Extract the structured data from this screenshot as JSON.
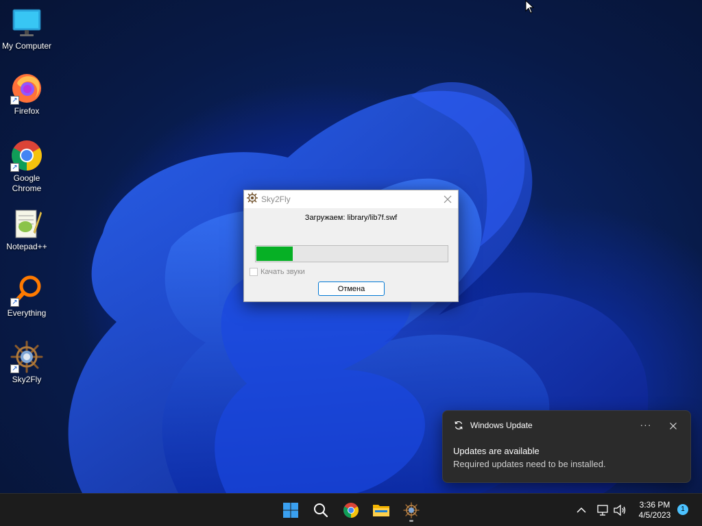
{
  "desktop": {
    "icons": [
      {
        "label_line1": "My Computer",
        "label_line2": ""
      },
      {
        "label_line1": "Firefox",
        "label_line2": ""
      },
      {
        "label_line1": "Google",
        "label_line2": "Chrome"
      },
      {
        "label_line1": "Notepad++",
        "label_line2": ""
      },
      {
        "label_line1": "Everything",
        "label_line2": ""
      },
      {
        "label_line1": "Sky2Fly",
        "label_line2": ""
      }
    ]
  },
  "dialog": {
    "title": "Sky2Fly",
    "loading_text": "Загружаем: library/lib7f.swf",
    "progress_percent": 19,
    "checkbox_label": "Качать звуки",
    "checkbox_checked": false,
    "cancel_label": "Отмена"
  },
  "toast": {
    "app_name": "Windows Update",
    "more_label": "···",
    "heading": "Updates are available",
    "body": "Required updates need to be installed."
  },
  "taskbar": {
    "pinned": [
      "start-icon",
      "search-icon",
      "chrome-icon",
      "file-explorer-icon",
      "sky2fly-icon"
    ],
    "time": "3:36 PM",
    "date": "4/5/2023",
    "notification_count": "1"
  },
  "colors": {
    "progress_fill": "#06b025",
    "accent": "#0078d4",
    "taskbar_bg": "#1c1c1c",
    "toast_bg": "#2b2b2b"
  }
}
